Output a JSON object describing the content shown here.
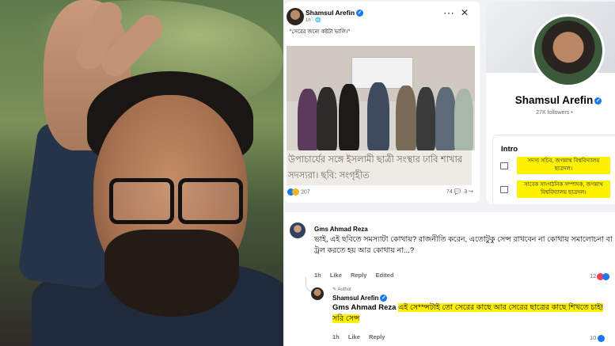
{
  "post": {
    "author": "Shamsul Arefin",
    "time": "1h",
    "caption": "\"সেরের জন্যে কষ্টটা ভালি।\"",
    "headline": "উপাচার্যের সঙ্গে ইসলামী ছাত্রী সংস্থার ঢাবি শাখার সদস্যরা। ছবি: সংগৃহীত",
    "reactions": "207",
    "comments_count": "74",
    "shares_count": "3"
  },
  "profile": {
    "name": "Shamsul Arefin",
    "followers": "27K followers •",
    "intro_title": "Intro",
    "intro_1": "সদস্য সচিব, জগন্নাথ বিশ্ববিদ্যালয় ছাত্রদল।",
    "intro_2": "সাবেক সাংগঠনিক সম্পাদক, জগন্নাথ বিশ্ববিদ্যালয় ছাত্রদল।"
  },
  "comment": {
    "author": "Gms Ahmad Reza",
    "text": "ভাই, এই ছবিতে সমস্যাটা কোথায়? রাজনীতি করেন, এতোটুকু সেন্স রাখবেন না কোথায় সমালোচনা বা ট্রল করতে হয় আর কোথায় না...?",
    "time": "1h",
    "like": "Like",
    "reply": "Reply",
    "edited": "Edited",
    "count": "12"
  },
  "reply": {
    "badge": "Author",
    "author": "Shamsul Arefin",
    "mention": "Gms Ahmad Reza",
    "text": "এই সে**ন্সটাই তো সেরের কাছে আর সেরের ছাত্রের কাছে শিখতে চাই! সরি সেন্স",
    "time": "1h",
    "like": "Like",
    "reply": "Reply",
    "count": "10"
  },
  "icons": [
    "verified-icon",
    "more-icon",
    "close-icon",
    "briefcase-icon",
    "like-reaction-icon",
    "heart-reaction-icon"
  ]
}
